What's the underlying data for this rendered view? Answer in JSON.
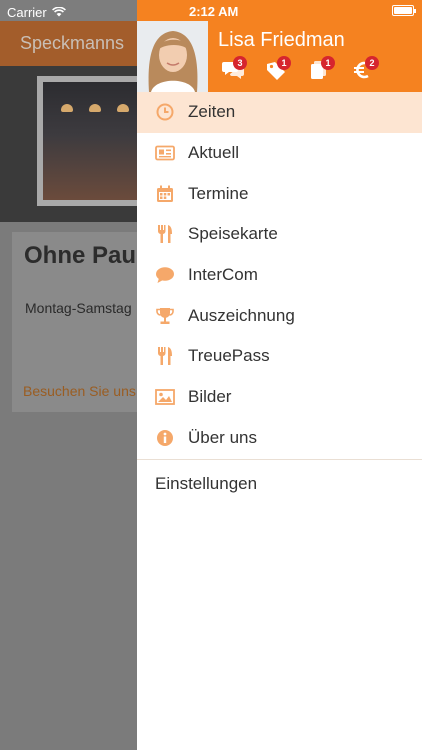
{
  "status": {
    "carrier": "Carrier",
    "time": "2:12 AM"
  },
  "background_app": {
    "title": "Speckmanns",
    "card_title": "Ohne Pau",
    "card_hours": "Montag-Samstag",
    "card_link": "Besuchen Sie uns"
  },
  "profile": {
    "name": "Lisa Friedman",
    "badges": [
      {
        "icon": "chat-icon",
        "count": "3"
      },
      {
        "icon": "tag-icon",
        "count": "1"
      },
      {
        "icon": "coupon-icon",
        "count": "1"
      },
      {
        "icon": "euro-icon",
        "count": "2"
      }
    ]
  },
  "menu": {
    "items": [
      {
        "label": "Zeiten",
        "icon": "clock-icon",
        "active": true
      },
      {
        "label": "Aktuell",
        "icon": "news-icon"
      },
      {
        "label": "Termine",
        "icon": "calendar-icon"
      },
      {
        "label": "Speisekarte",
        "icon": "cutlery-icon"
      },
      {
        "label": "InterCom",
        "icon": "speech-bubble-icon"
      },
      {
        "label": "Auszeichnung",
        "icon": "trophy-icon"
      },
      {
        "label": "TreuePass",
        "icon": "cutlery-icon"
      },
      {
        "label": "Bilder",
        "icon": "image-icon"
      },
      {
        "label": "Über uns",
        "icon": "info-icon"
      }
    ],
    "settings_label": "Einstellungen"
  },
  "colors": {
    "accent": "#f58220",
    "active_row": "#fde5d2",
    "badge": "#d6252e",
    "menu_icon": "#f5a86a"
  }
}
